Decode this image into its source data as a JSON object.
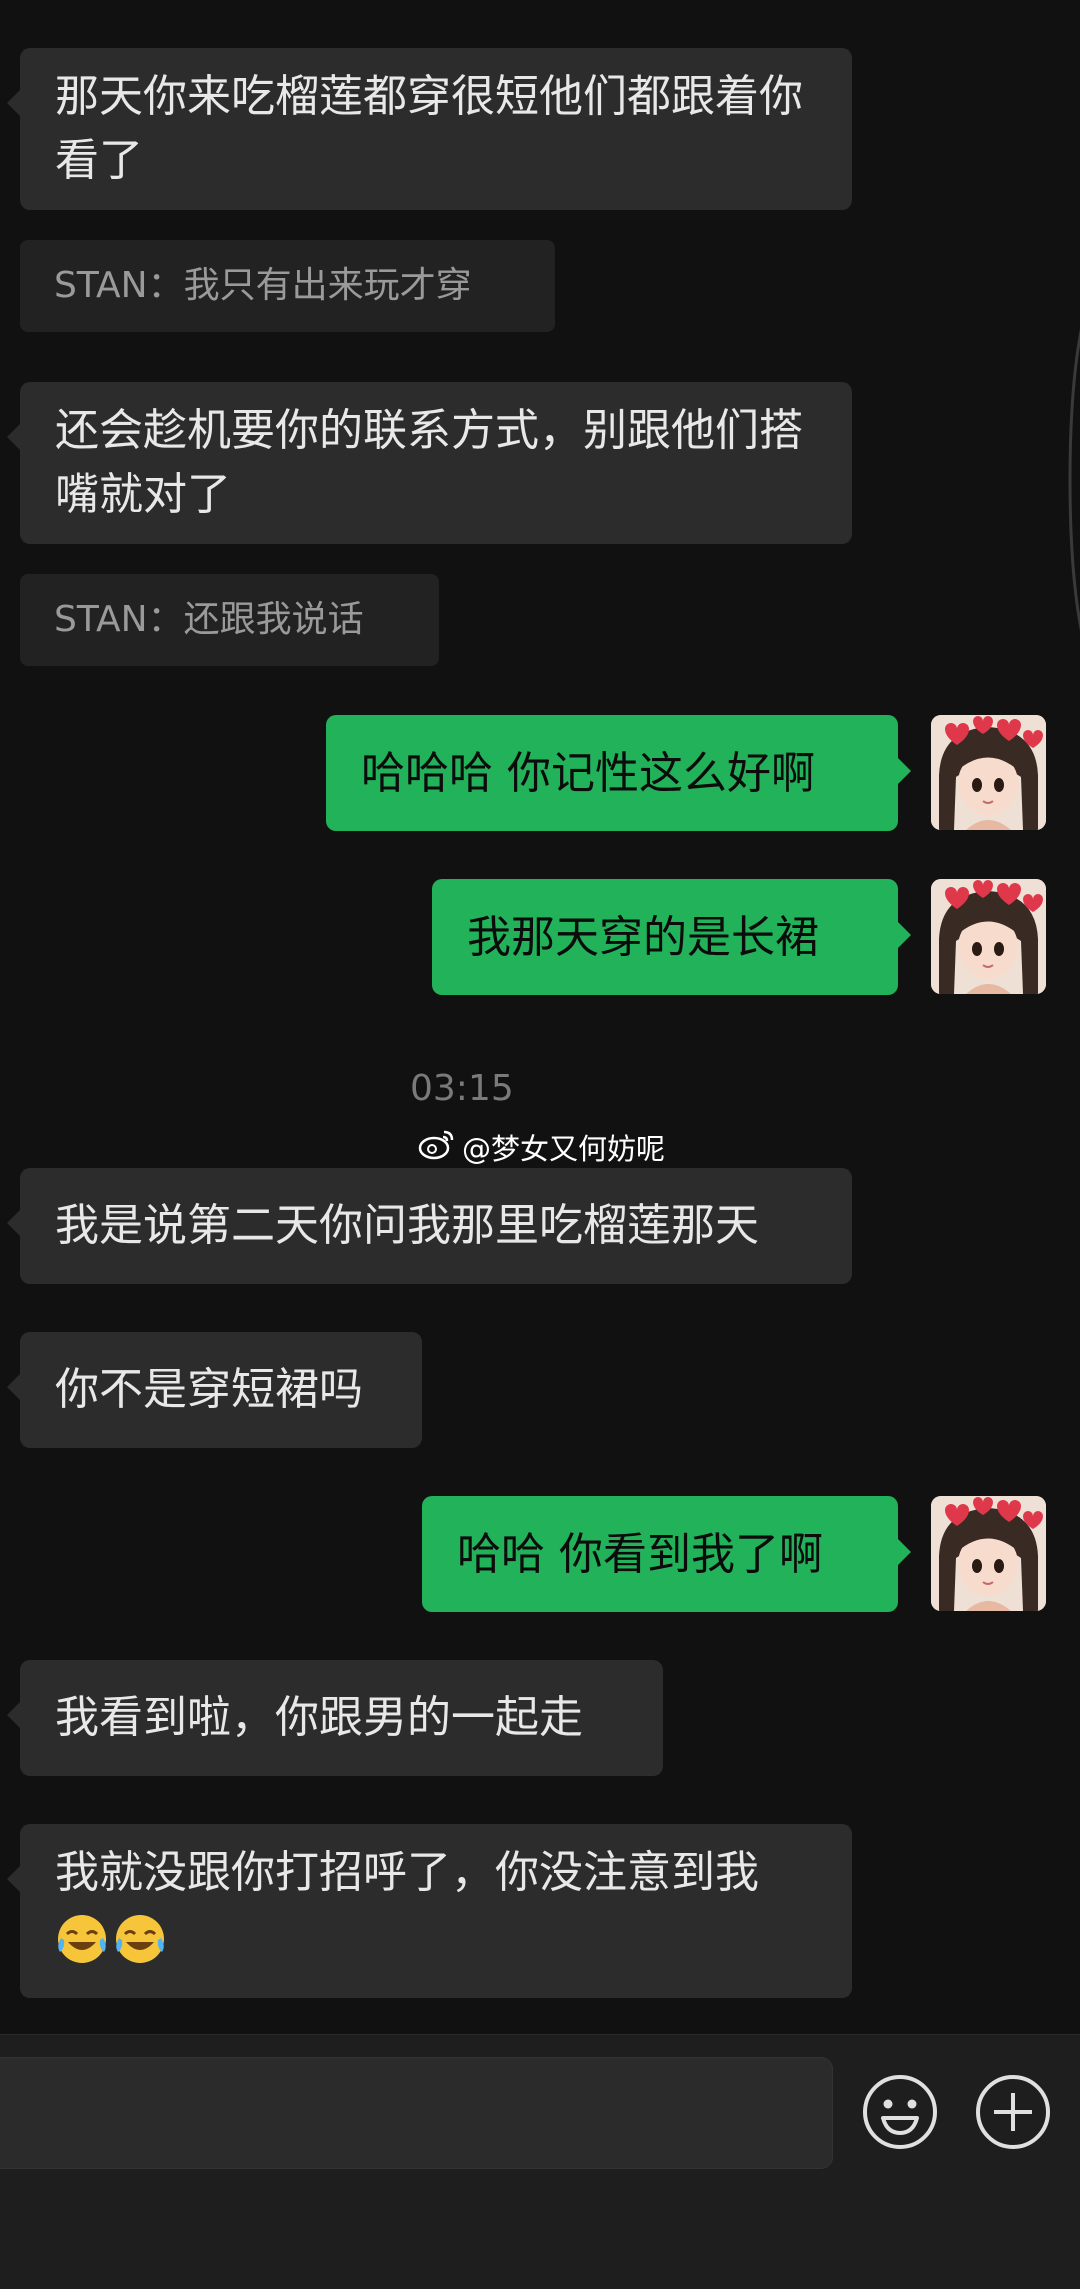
{
  "messages": [
    {
      "side": "in",
      "text": "那天你来吃榴莲都穿很短他们都跟着你看了"
    },
    {
      "side": "quote",
      "text": "STAN：我只有出来玩才穿"
    },
    {
      "side": "in",
      "text": "还会趁机要你的联系方式，别跟他们搭嘴就对了"
    },
    {
      "side": "quote",
      "text": "STAN：还跟我说话"
    },
    {
      "side": "out",
      "text": "哈哈哈 你记性这么好啊"
    },
    {
      "side": "out",
      "text": "我那天穿的是长裙"
    },
    {
      "side": "in",
      "text": "我是说第二天你问我那里吃榴莲那天"
    },
    {
      "side": "in",
      "text": "你不是穿短裙吗"
    },
    {
      "side": "out",
      "text": "哈哈 你看到我了啊"
    },
    {
      "side": "in",
      "text": "我看到啦，你跟男的一起走"
    },
    {
      "side": "in",
      "text": "我就没跟你打招呼了，你没注意到我",
      "emoji": [
        "laughing-crying-emoji",
        "laughing-crying-emoji"
      ]
    }
  ],
  "timestamp": "03:15",
  "watermark": {
    "icon": "weibo-icon",
    "text": "@梦女又何妨呢"
  },
  "input_bar": {
    "input_value": "",
    "buttons": [
      "emoji-button",
      "add-button"
    ]
  },
  "colors": {
    "background": "#111111",
    "incoming_bubble": "#2c2c2c",
    "outgoing_bubble": "#22b25a",
    "quote_bg": "#222222"
  }
}
